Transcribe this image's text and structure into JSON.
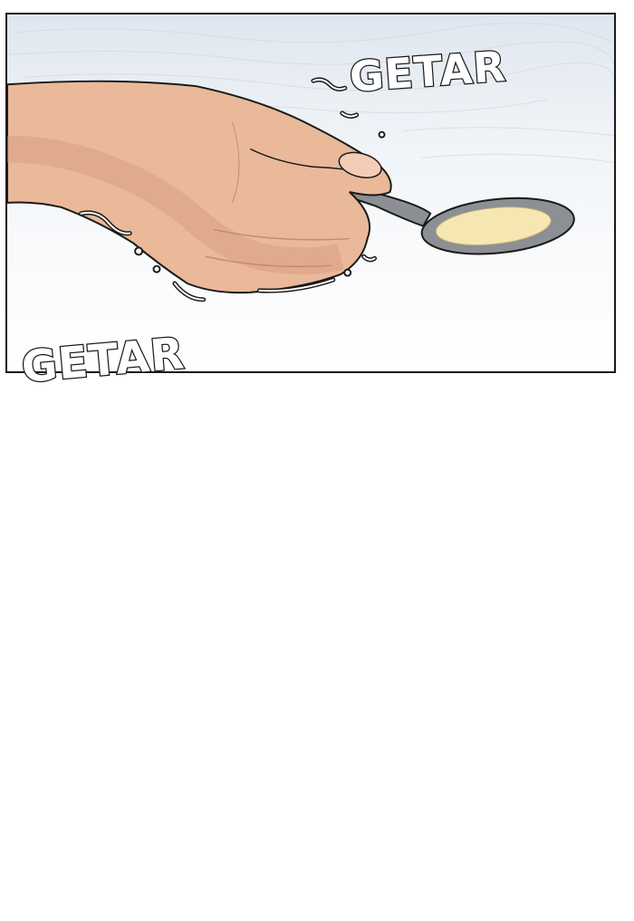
{
  "panel": {
    "scene": "hand-holding-spoon",
    "sound_effects": {
      "top": "GETAR",
      "bottom": "GETAR"
    }
  },
  "colors": {
    "skin": "#e9b99a",
    "skin_shadow": "#d49a7f",
    "spoon": "#8c8f93",
    "liquid": "#f6e7b2",
    "outline": "#1a1a1a"
  }
}
